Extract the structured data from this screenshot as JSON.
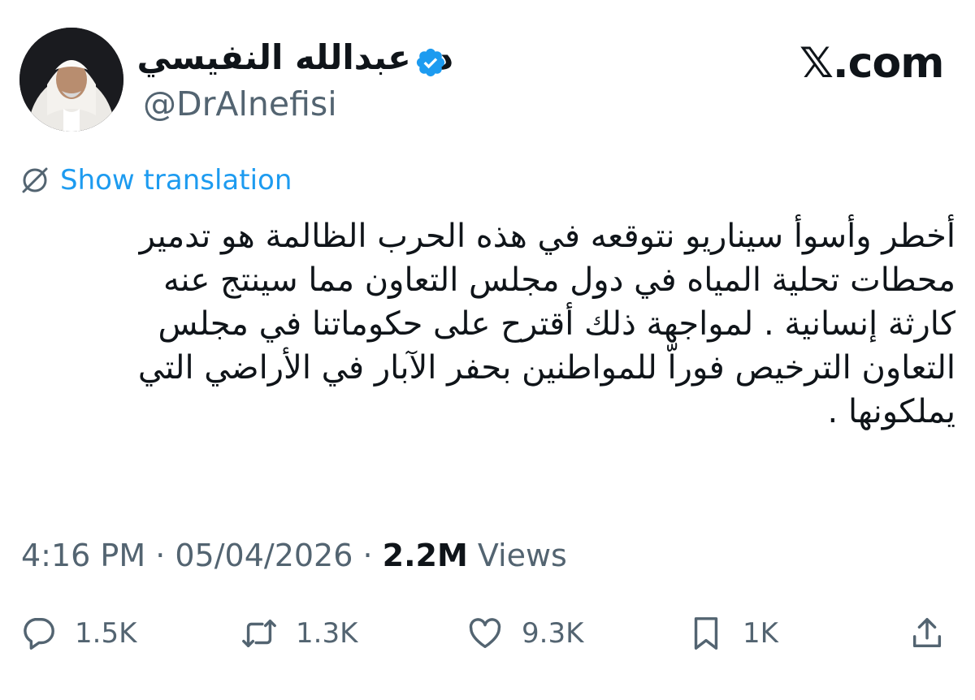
{
  "author": {
    "display_name": "د. عبدالله النفيسي",
    "handle": "@DrAlnefisi",
    "verified_badge_icon": "verified-badge-icon",
    "avatar_icon": "profile-avatar"
  },
  "brand": "𝕏.com",
  "translation": {
    "icon": "globe-translate-icon",
    "label": "Show translation"
  },
  "tweet": {
    "text": "أخطر وأسوأ سيناريو نتوقعه في هذه الحرب الظالمة هو تدمير\nمحطات تحلية المياه في دول مجلس التعاون مما سينتج عنه\nكارثة إنسانية . لمواجهة ذلك أقترح على حكوماتنا في مجلس\nالتعاون الترخيص فوراّ للمواطنين بحفر الآبار في الأراضي التي\nيملكونها ."
  },
  "meta": {
    "time": "4:16 PM",
    "separator": " · ",
    "date": "05/04/2026",
    "views_count": "2.2M",
    "views_label": " Views"
  },
  "actions": {
    "replies": "1.5K",
    "reposts": "1.3K",
    "likes": "9.3K",
    "bookmarks": "1K"
  },
  "colors": {
    "accent": "#1d9bf0",
    "text": "#0f1419",
    "muted": "#536471"
  }
}
